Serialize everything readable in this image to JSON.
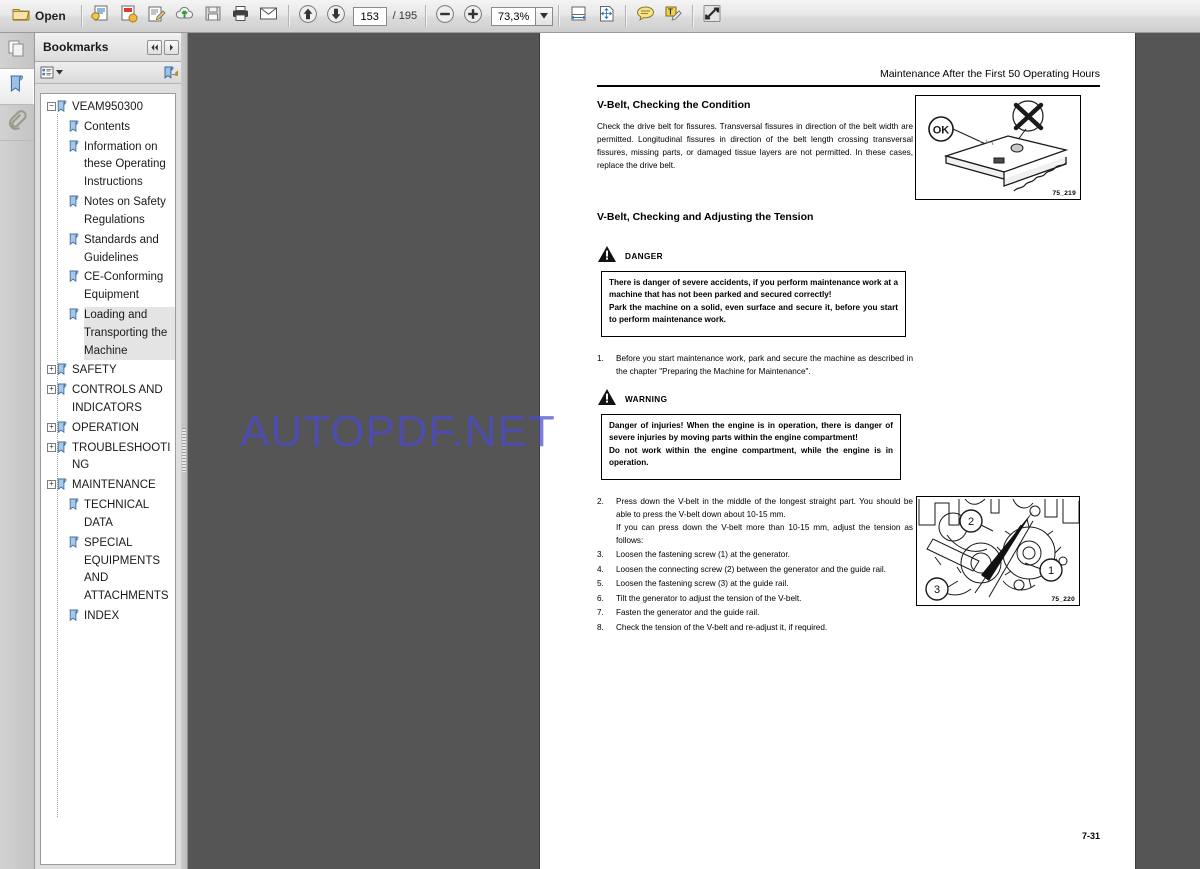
{
  "toolbar": {
    "open_label": "Open",
    "icons": [
      {
        "name": "open-folder-icon"
      },
      {
        "name": "save-copy-icon"
      },
      {
        "name": "create-pdf-icon"
      },
      {
        "name": "edit-pdf-icon"
      },
      {
        "name": "upload-cloud-icon"
      },
      {
        "name": "save-icon"
      },
      {
        "name": "print-icon"
      },
      {
        "name": "email-icon"
      },
      {
        "name": "previous-page-icon"
      },
      {
        "name": "next-page-icon"
      },
      {
        "name": "zoom-out-icon"
      },
      {
        "name": "zoom-in-icon"
      },
      {
        "name": "fit-width-icon"
      },
      {
        "name": "fit-page-icon"
      },
      {
        "name": "sticky-note-icon"
      },
      {
        "name": "highlight-text-icon"
      },
      {
        "name": "full-screen-icon"
      }
    ],
    "current_page": "153",
    "page_separator": "/ 195",
    "total_pages": "195",
    "zoom_level": "73,3%",
    "zoom_dropdown_glyph": "▼"
  },
  "rail": {
    "items": [
      {
        "name": "page-thumbnails-icon",
        "label": "Page Thumbnails",
        "selected": false
      },
      {
        "name": "bookmarks-icon",
        "label": "Bookmarks",
        "selected": true
      },
      {
        "name": "attachments-icon",
        "label": "Attachments",
        "selected": false
      }
    ]
  },
  "bookmarks_panel": {
    "title": "Bookmarks",
    "nav_prev_glyph": "◀◀",
    "nav_next_glyph": "▶",
    "options_menu_glyph": "▼",
    "options_icon": "list-options-icon",
    "new_bookmark_icon": "new-bookmark-icon",
    "items": [
      {
        "label": "VEAM950300",
        "level": 0,
        "twisty": "minus",
        "selected": false
      },
      {
        "label": "Contents",
        "level": 1,
        "twisty": "none",
        "selected": false
      },
      {
        "label": "Information on these Operating Instructions",
        "level": 1,
        "twisty": "none",
        "selected": false
      },
      {
        "label": "Notes on Safety Regulations",
        "level": 1,
        "twisty": "none",
        "selected": false
      },
      {
        "label": "Standards and Guidelines",
        "level": 1,
        "twisty": "none",
        "selected": false
      },
      {
        "label": "CE-Conforming Equipment",
        "level": 1,
        "twisty": "none",
        "selected": false
      },
      {
        "label": "Loading and Transporting the Machine",
        "level": 1,
        "twisty": "none",
        "selected": true
      },
      {
        "label": "SAFETY",
        "level": 0,
        "twisty": "plus",
        "selected": false
      },
      {
        "label": "CONTROLS AND INDICATORS",
        "level": 0,
        "twisty": "plus",
        "selected": false
      },
      {
        "label": "OPERATION",
        "level": 0,
        "twisty": "plus",
        "selected": false
      },
      {
        "label": "TROUBLESHOOTING",
        "level": 0,
        "twisty": "plus",
        "selected": false
      },
      {
        "label": "MAINTENANCE",
        "level": 0,
        "twisty": "plus",
        "selected": false
      },
      {
        "label": "TECHNICAL DATA",
        "level": 1,
        "twisty": "none",
        "selected": false
      },
      {
        "label": "SPECIAL EQUIPMENTS AND ATTACHMENTS",
        "level": 1,
        "twisty": "none",
        "selected": false
      },
      {
        "label": "INDEX",
        "level": 1,
        "twisty": "none",
        "selected": false
      }
    ]
  },
  "document": {
    "watermark": "AUTOPDF.NET",
    "watermark_color": "#4b4bd0",
    "header": "Maintenance After the First 50 Operating Hours",
    "page_number": "7-31",
    "section1": {
      "heading": "V-Belt, Checking the Condition",
      "body": "Check the drive belt for fissures. Transversal fissures in direction of the belt width are permitted. Longitudinal fissures in direction of the belt length crossing transversal fissures, missing parts, or damaged tissue layers are not permitted. In these cases, replace the drive belt."
    },
    "section2": {
      "heading": "V-Belt, Checking and Adjusting the Tension"
    },
    "danger": {
      "label": "DANGER",
      "text": "There is danger of severe accidents, if you perform maintenance work at a machine that has not been parked and secured correctly!\nPark the machine on a solid, even surface and secure it, before you start to perform maintenance work."
    },
    "warning": {
      "label": "WARNING",
      "text": "Danger of injuries! When the engine is in operation, there is danger of severe injuries by moving parts within the engine compartment!\nDo not work within the engine compartment, while the engine is in operation."
    },
    "steps_before_warning": [
      {
        "num": "1.",
        "text": "Before you start maintenance work, park and secure the machine as described in the chapter \"Preparing the Machine for Maintenance\"."
      }
    ],
    "steps_after_warning": [
      {
        "num": "2.",
        "text": "Press down the V-belt in the middle of the longest straight part. You should be able to press the V-belt down about 10-15 mm.\nIf you can press down the V-belt more than 10-15 mm, adjust the tension as follows:"
      },
      {
        "num": "3.",
        "text": "Loosen the fastening screw (1) at the generator."
      },
      {
        "num": "4.",
        "text": "Loosen the connecting screw (2) between the generator and the guide rail."
      },
      {
        "num": "5.",
        "text": "Loosen the fastening screw (3) at the guide rail."
      },
      {
        "num": "6.",
        "text": "Tilt the generator to adjust the tension of the V-belt."
      },
      {
        "num": "7.",
        "text": "Fasten the generator and the guide rail."
      },
      {
        "num": "8.",
        "text": "Check the tension of the V-belt and re-adjust it, if required."
      }
    ],
    "figure1": {
      "caption": "75_219",
      "ok_label": "OK",
      "name": "v-belt-condition-figure"
    },
    "figure2": {
      "caption": "75_220",
      "callouts": [
        "1",
        "2",
        "3"
      ],
      "name": "v-belt-tension-figure"
    }
  }
}
